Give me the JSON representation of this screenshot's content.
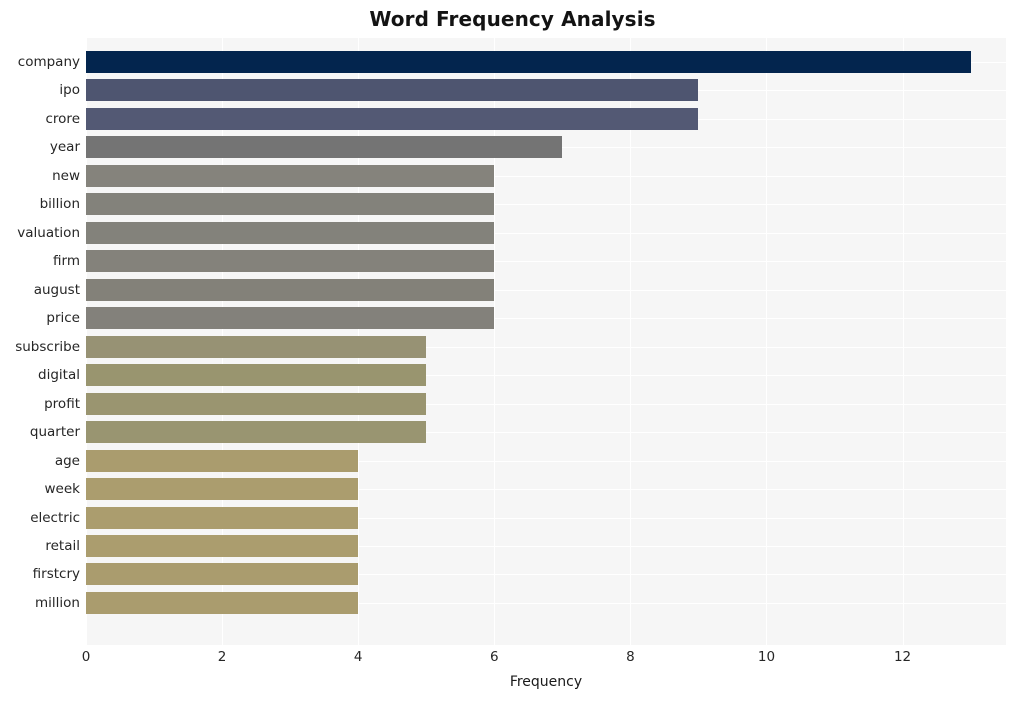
{
  "chart_data": {
    "type": "bar",
    "orientation": "horizontal",
    "title": "Word Frequency Analysis",
    "xlabel": "Frequency",
    "ylabel": "",
    "xlim": [
      0,
      13.52
    ],
    "xticks": [
      0,
      2,
      4,
      6,
      8,
      10,
      12
    ],
    "xtick_labels": [
      "0",
      "2",
      "4",
      "6",
      "8",
      "10",
      "12"
    ],
    "grid": true,
    "legend": false,
    "categories": [
      "company",
      "ipo",
      "crore",
      "year",
      "new",
      "billion",
      "valuation",
      "firm",
      "august",
      "price",
      "subscribe",
      "digital",
      "profit",
      "quarter",
      "age",
      "week",
      "electric",
      "retail",
      "firstcry",
      "million"
    ],
    "values": [
      13,
      9,
      9,
      7,
      6,
      6,
      6,
      6,
      6,
      6,
      5,
      5,
      5,
      5,
      4,
      4,
      4,
      4,
      4,
      4
    ],
    "bar_colors": [
      "#03254e",
      "#4e5570",
      "#535974",
      "#747474",
      "#85837c",
      "#83827b",
      "#83827b",
      "#84827b",
      "#838179",
      "#83817b",
      "#979274",
      "#99956f",
      "#9a9570",
      "#999571",
      "#aa9c6e",
      "#ab9d6e",
      "#ab9d6e",
      "#ab9d6e",
      "#aa9c6e",
      "#aa9c6e"
    ],
    "plot_background": "#f6f6f6",
    "gridline_color": "#ffffff",
    "page_background": "#ffffff"
  }
}
